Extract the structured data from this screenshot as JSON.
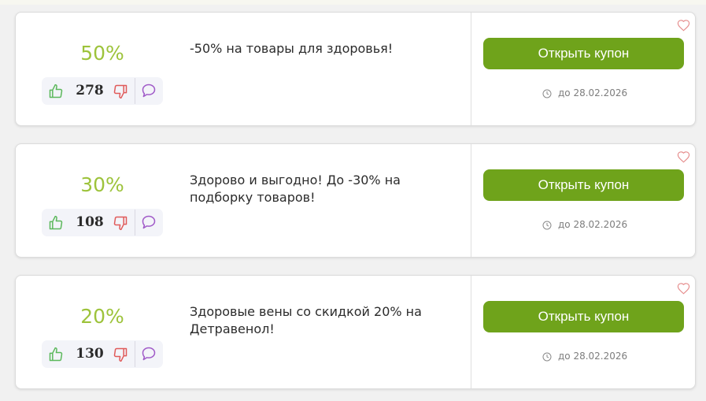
{
  "colors": {
    "discount": "#9dc33b",
    "button": "#6fa31b",
    "thumb_up": "#5cb85c",
    "thumb_down": "#e05a5a",
    "comment": "#a05ac8",
    "heart": "#e58a8a"
  },
  "coupons": [
    {
      "discount": "50%",
      "votes": "278",
      "description": "-50% на товары для здоровья!",
      "button_label": "Открыть купон",
      "expiry": "до 28.02.2026"
    },
    {
      "discount": "30%",
      "votes": "108",
      "description": "Здорово и выгодно! До -30% на подборку товаров!",
      "button_label": "Открыть купон",
      "expiry": "до 28.02.2026"
    },
    {
      "discount": "20%",
      "votes": "130",
      "description": "Здоровые вены со скидкой 20% на Детравенол!",
      "button_label": "Открыть купон",
      "expiry": "до 28.02.2026"
    }
  ],
  "icons": {
    "vote_up": "thumbs-up-icon",
    "vote_down": "thumbs-down-icon",
    "comment": "comment-icon",
    "expiry": "clock-icon",
    "favorite": "heart-icon"
  }
}
